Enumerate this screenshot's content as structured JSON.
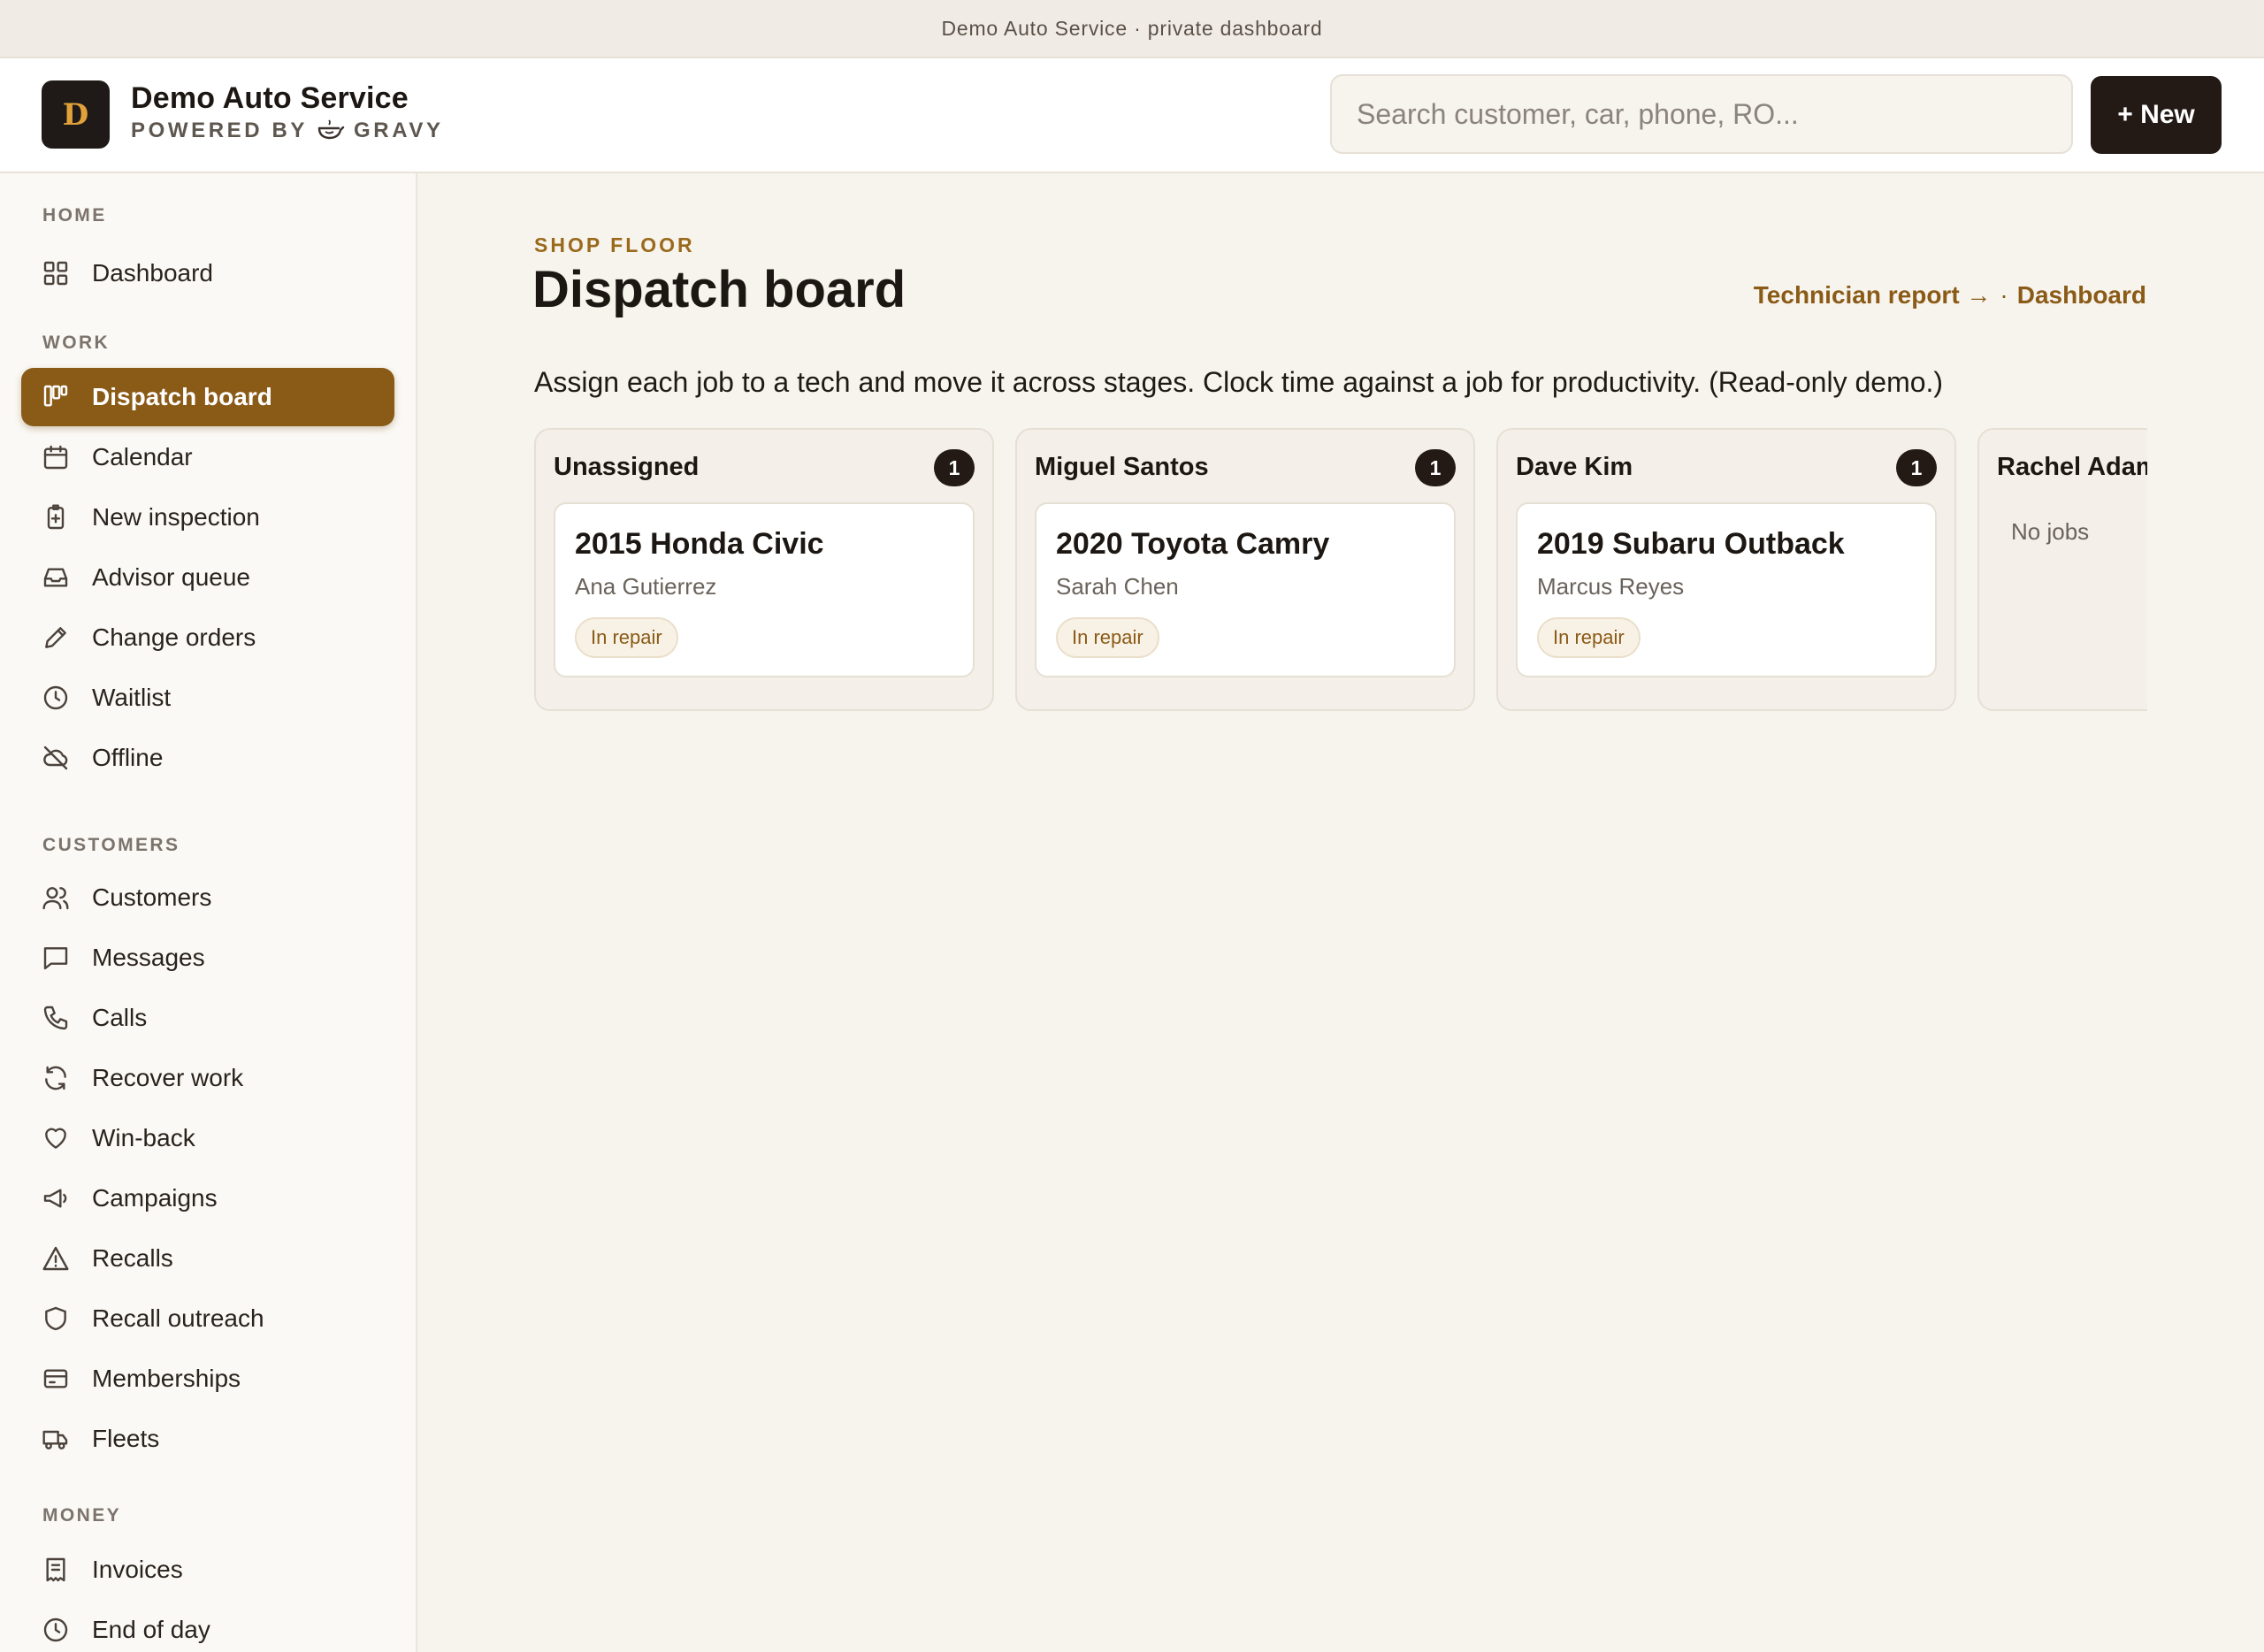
{
  "banner": {
    "text": "Demo Auto Service · private dashboard"
  },
  "header": {
    "logo_letter": "D",
    "brand_name": "Demo Auto Service",
    "powered_by": "POWERED BY",
    "powered_brand": "GRAVY",
    "search_placeholder": "Search customer, car, phone, RO...",
    "new_button": "+ New"
  },
  "sidebar": {
    "sections": [
      {
        "title": "HOME",
        "items": [
          {
            "label": "Dashboard",
            "icon": "grid-icon"
          }
        ]
      },
      {
        "title": "WORK",
        "items": [
          {
            "label": "Dispatch board",
            "icon": "kanban-icon",
            "active": true
          },
          {
            "label": "Calendar",
            "icon": "calendar-icon"
          },
          {
            "label": "New inspection",
            "icon": "clipboard-plus-icon"
          },
          {
            "label": "Advisor queue",
            "icon": "inbox-icon"
          },
          {
            "label": "Change orders",
            "icon": "pencil-icon"
          },
          {
            "label": "Waitlist",
            "icon": "clock-icon"
          },
          {
            "label": "Offline",
            "icon": "cloud-off-icon"
          }
        ]
      },
      {
        "title": "CUSTOMERS",
        "items": [
          {
            "label": "Customers",
            "icon": "users-icon"
          },
          {
            "label": "Messages",
            "icon": "message-icon"
          },
          {
            "label": "Calls",
            "icon": "phone-icon"
          },
          {
            "label": "Recover work",
            "icon": "refresh-icon"
          },
          {
            "label": "Win-back",
            "icon": "heart-icon"
          },
          {
            "label": "Campaigns",
            "icon": "megaphone-icon"
          },
          {
            "label": "Recalls",
            "icon": "warning-icon"
          },
          {
            "label": "Recall outreach",
            "icon": "shield-icon"
          },
          {
            "label": "Memberships",
            "icon": "card-icon"
          },
          {
            "label": "Fleets",
            "icon": "truck-icon"
          }
        ]
      },
      {
        "title": "MONEY",
        "items": [
          {
            "label": "Invoices",
            "icon": "receipt-icon"
          },
          {
            "label": "End of day",
            "icon": "clock-icon"
          }
        ]
      }
    ]
  },
  "main": {
    "eyebrow": "SHOP FLOOR",
    "title": "Dispatch board",
    "link_technician": "Technician report →",
    "link_sep": "·",
    "link_dashboard": "Dashboard",
    "description": "Assign each job to a tech and move it across stages. Clock time against a job for productivity. (Read-only demo.)",
    "no_jobs": "No jobs",
    "columns": [
      {
        "name": "Unassigned",
        "count": "1",
        "job": {
          "car": "2015 Honda Civic",
          "customer": "Ana Gutierrez",
          "status": "In repair"
        }
      },
      {
        "name": "Miguel Santos",
        "count": "1",
        "job": {
          "car": "2020 Toyota Camry",
          "customer": "Sarah Chen",
          "status": "In repair"
        }
      },
      {
        "name": "Dave Kim",
        "count": "1",
        "job": {
          "car": "2019 Subaru Outback",
          "customer": "Marcus Reyes",
          "status": "In repair"
        }
      },
      {
        "name": "Rachel Adams",
        "count": "",
        "job": null
      }
    ]
  }
}
